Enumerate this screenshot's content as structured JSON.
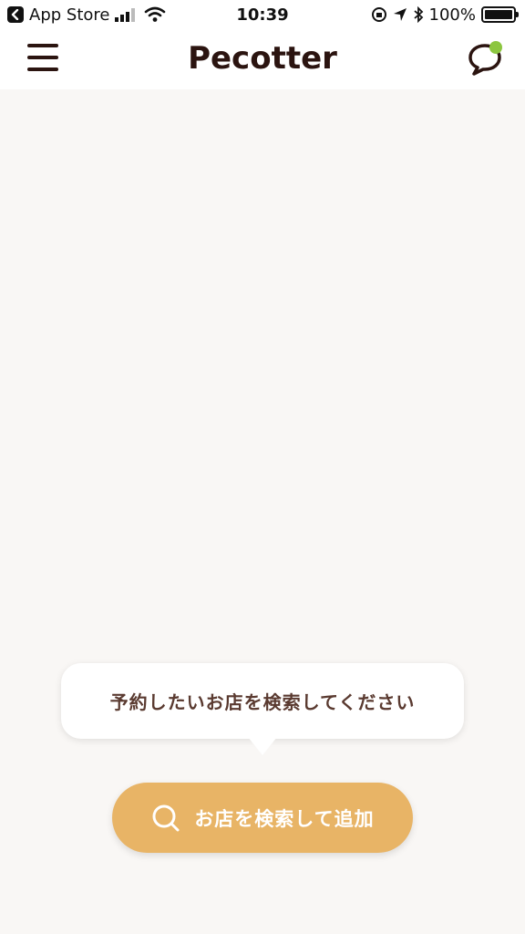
{
  "status_bar": {
    "back_app": "App Store",
    "time": "10:39",
    "battery_percent": "100%",
    "battery_level": 1.0,
    "icons": [
      "back-icon",
      "signal-icon",
      "wifi-icon",
      "orientation-lock-icon",
      "location-icon",
      "bluetooth-icon",
      "battery-icon"
    ]
  },
  "header": {
    "logo": "Pecotter",
    "menu_icon": "hamburger-menu-icon",
    "chat_icon": "chat-bubble-icon",
    "chat_notification_color": "#8cc63f"
  },
  "main": {
    "tooltip_text": "予約したいお店を検索してください",
    "search_button_label": "お店を検索して追加",
    "search_icon": "search-icon"
  },
  "colors": {
    "brand_dark": "#2b1410",
    "accent": "#e8b466",
    "tooltip_text": "#5a3a30",
    "background": "#f9f7f5"
  }
}
